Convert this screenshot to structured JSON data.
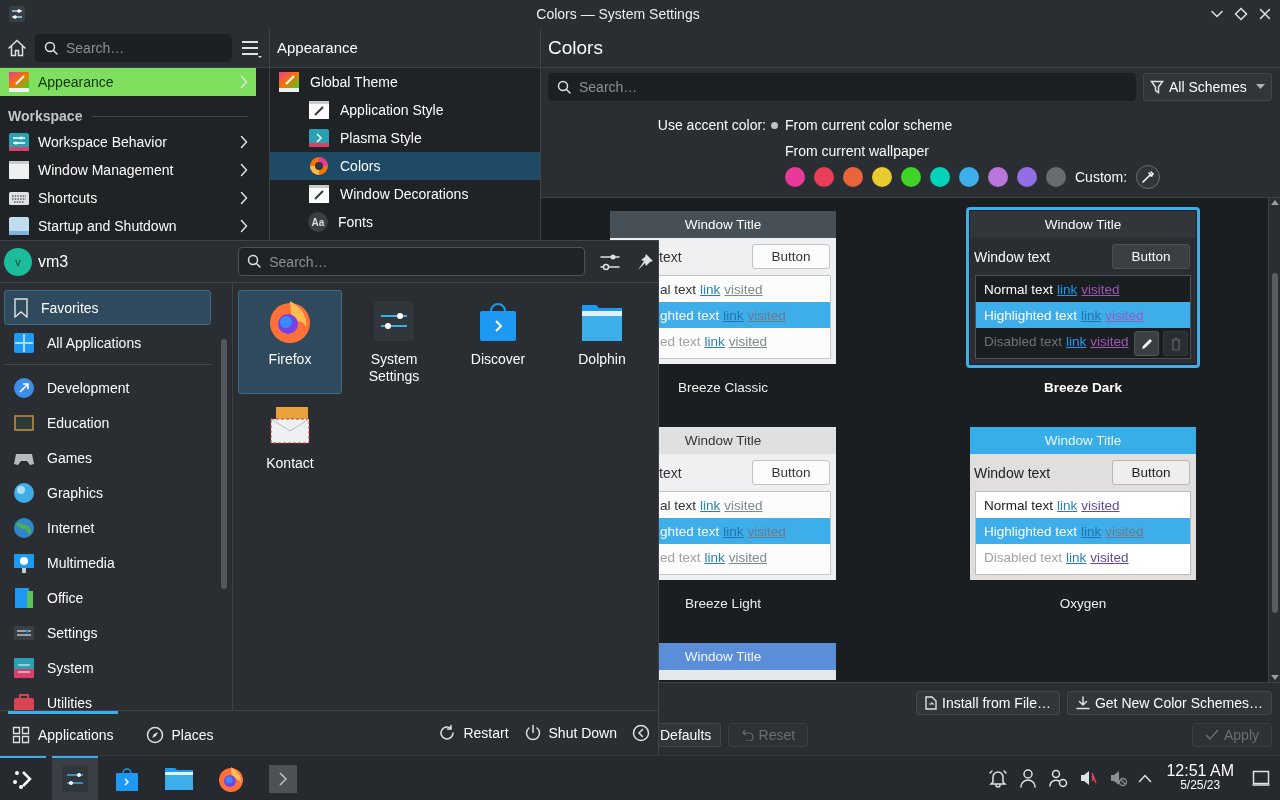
{
  "window": {
    "title": "Colors — System Settings"
  },
  "sidebar": {
    "search": {
      "placeholder": "Search…"
    },
    "items": [
      {
        "kind": "item",
        "label": "Appearance",
        "selected": true
      },
      {
        "kind": "heading",
        "label": "Workspace"
      },
      {
        "kind": "item",
        "label": "Workspace Behavior",
        "selected": false
      },
      {
        "kind": "item",
        "label": "Window Management",
        "selected": false
      },
      {
        "kind": "item",
        "label": "Shortcuts",
        "selected": false
      },
      {
        "kind": "item",
        "label": "Startup and Shutdown",
        "selected": false
      }
    ]
  },
  "subpage": {
    "title": "Appearance",
    "items": [
      {
        "label": "Global Theme",
        "selected": false,
        "children": [
          {
            "label": "Application Style",
            "selected": false
          },
          {
            "label": "Plasma Style",
            "selected": false
          },
          {
            "label": "Colors",
            "selected": true
          },
          {
            "label": "Window Decorations",
            "selected": false
          },
          {
            "label": "Fonts",
            "selected": false,
            "glyph": "Aa"
          }
        ]
      }
    ]
  },
  "page": {
    "title": "Colors",
    "search": {
      "placeholder": "Search…"
    },
    "filter": "All Schemes",
    "accent": {
      "label": "Use accent color:",
      "options": [
        {
          "label": "From current color scheme",
          "selected": true
        },
        {
          "label": "From current wallpaper",
          "selected": false
        }
      ],
      "swatches": [
        {
          "color": "#e93a9a"
        },
        {
          "color": "#e93d58"
        },
        {
          "color": "#e9643a"
        },
        {
          "color": "#e8cb2d"
        },
        {
          "color": "#3dd425"
        },
        {
          "color": "#00d3b8"
        },
        {
          "color": "#3daee9"
        },
        {
          "color": "#b875dc"
        },
        {
          "color": "#926ee4"
        },
        {
          "color": "#686b6f"
        }
      ],
      "custom_label": "Custom:"
    },
    "schemes": [
      {
        "kind": "classic",
        "selected": false,
        "name": "Breeze Classic",
        "title": "Window Title",
        "window_text": "text",
        "button": "Button",
        "rows": [
          {
            "kind": "normal",
            "text": "al text",
            "link": "link",
            "visited": "visited"
          },
          {
            "kind": "highlighted",
            "text": "ghted text",
            "link": "link",
            "visited": "visited"
          },
          {
            "kind": "disabled",
            "text": "ed text",
            "link": "link",
            "visited": "visited"
          }
        ]
      },
      {
        "kind": "dark",
        "selected": true,
        "name": "Breeze Dark",
        "title": "Window Title",
        "window_text": "Window text",
        "button": "Button",
        "rows": [
          {
            "kind": "normal",
            "text": "Normal text",
            "link": "link",
            "visited": "visited"
          },
          {
            "kind": "highlighted",
            "text": "Highlighted text",
            "link": "link",
            "visited": "visited"
          },
          {
            "kind": "disabled",
            "text": "Disabled text",
            "link": "link",
            "visited": "visited"
          }
        ]
      },
      {
        "kind": "light",
        "selected": false,
        "name": "Breeze Light",
        "title": "Window Title",
        "window_text": "text",
        "button": "Button",
        "rows": [
          {
            "kind": "normal",
            "text": "al text",
            "link": "link",
            "visited": "visited"
          },
          {
            "kind": "highlighted",
            "text": "ghted text",
            "link": "link",
            "visited": "visited"
          },
          {
            "kind": "disabled",
            "text": "ed text",
            "link": "link",
            "visited": "visited"
          }
        ]
      },
      {
        "kind": "oxygen",
        "selected": false,
        "name": "Oxygen",
        "title": "Window Title",
        "window_text": "Window text",
        "button": "Button",
        "rows": [
          {
            "kind": "normal",
            "text": "Normal text",
            "link": "link",
            "visited": "visited"
          },
          {
            "kind": "highlighted",
            "text": "Highlighted text",
            "link": "link",
            "visited": "visited"
          },
          {
            "kind": "disabled",
            "text": "Disabled text",
            "link": "link",
            "visited": "visited"
          }
        ]
      },
      {
        "kind": "blue",
        "selected": false,
        "title": "Window Title"
      }
    ],
    "actions": [
      {
        "label": "Install from File…"
      },
      {
        "label": "Get New Color Schemes…"
      }
    ],
    "footer": [
      {
        "label": "Defaults",
        "disabled": false
      },
      {
        "label": "Reset",
        "disabled": true
      },
      {
        "label": "Apply",
        "disabled": true
      }
    ]
  },
  "launcher": {
    "user": {
      "initial": "v",
      "name": "vm3"
    },
    "search": {
      "placeholder": "Search…"
    },
    "top_items": [
      {
        "label": "Favorites",
        "selected": true
      },
      {
        "label": "All Applications",
        "selected": false
      }
    ],
    "categories": [
      {
        "label": "Development"
      },
      {
        "label": "Education"
      },
      {
        "label": "Games"
      },
      {
        "label": "Graphics"
      },
      {
        "label": "Internet"
      },
      {
        "label": "Multimedia"
      },
      {
        "label": "Office"
      },
      {
        "label": "Settings"
      },
      {
        "label": "System"
      },
      {
        "label": "Utilities"
      }
    ],
    "apps": [
      {
        "label": "Firefox",
        "selected": true
      },
      {
        "label": "System Settings",
        "selected": false
      },
      {
        "label": "Discover",
        "selected": false
      },
      {
        "label": "Dolphin",
        "selected": false
      },
      {
        "label": "Kontact",
        "selected": false
      }
    ],
    "tabs": [
      {
        "label": "Applications",
        "selected": true
      },
      {
        "label": "Places",
        "selected": false
      }
    ],
    "actions": [
      {
        "label": "Restart"
      },
      {
        "label": "Shut Down"
      }
    ]
  },
  "taskbar": {
    "tasks": [
      {
        "active": true
      },
      {
        "active": true
      },
      {
        "active": false
      },
      {
        "active": false
      },
      {
        "active": false
      },
      {
        "active": false
      }
    ],
    "clock": {
      "time": "12:51 AM",
      "date": "5/25/23"
    }
  }
}
